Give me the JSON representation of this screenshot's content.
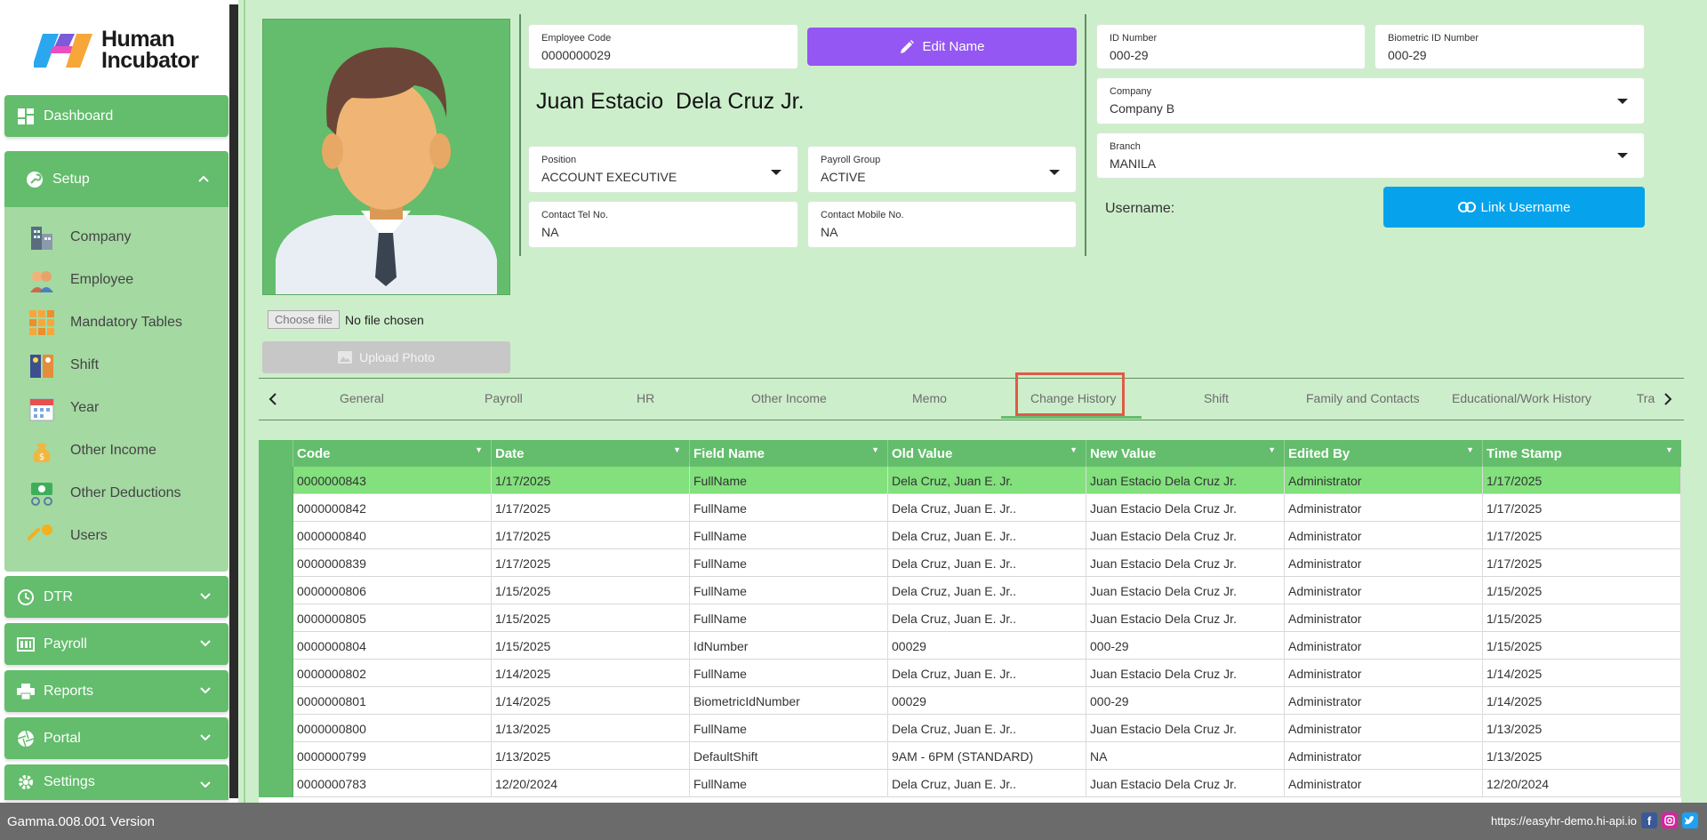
{
  "brand": {
    "line1": "Human",
    "line2": "Incubator"
  },
  "sidebar": {
    "dashboard": "Dashboard",
    "setup": "Setup",
    "setup_items": [
      {
        "label": "Company",
        "icon": "building-icon"
      },
      {
        "label": "Employee",
        "icon": "people-icon"
      },
      {
        "label": "Mandatory Tables",
        "icon": "grid-icon"
      },
      {
        "label": "Shift",
        "icon": "shift-icon"
      },
      {
        "label": "Year",
        "icon": "calendar-icon"
      },
      {
        "label": "Other Income",
        "icon": "money-bag-icon"
      },
      {
        "label": "Other Deductions",
        "icon": "deduction-icon"
      },
      {
        "label": "Users",
        "icon": "key-icon"
      }
    ],
    "dtr": "DTR",
    "payroll": "Payroll",
    "reports": "Reports",
    "portal": "Portal",
    "settings": "Settings"
  },
  "employee": {
    "code_label": "Employee Code",
    "code": "0000000029",
    "edit_name": "Edit Name",
    "full_name": "Juan Estacio  Dela Cruz Jr.",
    "position_label": "Position",
    "position": "ACCOUNT EXECUTIVE",
    "payroll_group_label": "Payroll Group",
    "payroll_group": "ACTIVE",
    "contact_tel_label": "Contact Tel No.",
    "contact_tel": "NA",
    "contact_mobile_label": "Contact Mobile No.",
    "contact_mobile": "NA",
    "id_number_label": "ID Number",
    "id_number": "000-29",
    "biometric_label": "Biometric ID Number",
    "biometric": "000-29",
    "company_label": "Company",
    "company": "Company B",
    "branch_label": "Branch",
    "branch": "MANILA",
    "username_label": "Username:",
    "link_username": "Link Username"
  },
  "photo": {
    "choose_file": "Choose file",
    "no_file": "No file chosen",
    "upload": "Upload Photo"
  },
  "tabs": [
    "General",
    "Payroll",
    "HR",
    "Other Income",
    "Memo",
    "Change History",
    "Shift",
    "Family and Contacts",
    "Educational/Work History",
    "Tra"
  ],
  "active_tab": "Change History",
  "table": {
    "columns": [
      "Code",
      "Date",
      "Field Name",
      "Old Value",
      "New Value",
      "Edited By",
      "Time Stamp"
    ],
    "rows": [
      [
        "0000000843",
        "1/17/2025",
        "FullName",
        "Dela Cruz, Juan E. Jr.",
        "Juan Estacio Dela Cruz Jr.",
        "Administrator",
        "1/17/2025"
      ],
      [
        "0000000842",
        "1/17/2025",
        "FullName",
        "Dela Cruz, Juan E. Jr..",
        "Juan Estacio Dela Cruz Jr.",
        "Administrator",
        "1/17/2025"
      ],
      [
        "0000000840",
        "1/17/2025",
        "FullName",
        "Dela Cruz, Juan E. Jr..",
        "Juan Estacio Dela Cruz Jr.",
        "Administrator",
        "1/17/2025"
      ],
      [
        "0000000839",
        "1/17/2025",
        "FullName",
        "Dela Cruz, Juan E. Jr..",
        "Juan Estacio Dela Cruz Jr.",
        "Administrator",
        "1/17/2025"
      ],
      [
        "0000000806",
        "1/15/2025",
        "FullName",
        "Dela Cruz, Juan E. Jr..",
        "Juan Estacio Dela Cruz Jr.",
        "Administrator",
        "1/15/2025"
      ],
      [
        "0000000805",
        "1/15/2025",
        "FullName",
        "Dela Cruz, Juan E. Jr..",
        "Juan Estacio Dela Cruz Jr.",
        "Administrator",
        "1/15/2025"
      ],
      [
        "0000000804",
        "1/15/2025",
        "IdNumber",
        "00029",
        "000-29",
        "Administrator",
        "1/15/2025"
      ],
      [
        "0000000802",
        "1/14/2025",
        "FullName",
        "Dela Cruz, Juan E. Jr..",
        "Juan Estacio Dela Cruz Jr.",
        "Administrator",
        "1/14/2025"
      ],
      [
        "0000000801",
        "1/14/2025",
        "BiometricIdNumber",
        "00029",
        "000-29",
        "Administrator",
        "1/14/2025"
      ],
      [
        "0000000800",
        "1/13/2025",
        "FullName",
        "Dela Cruz, Juan E. Jr..",
        "Juan Estacio Dela Cruz Jr.",
        "Administrator",
        "1/13/2025"
      ],
      [
        "0000000799",
        "1/13/2025",
        "DefaultShift",
        "9AM - 6PM (STANDARD)",
        "NA",
        "Administrator",
        "1/13/2025"
      ],
      [
        "0000000783",
        "12/20/2024",
        "FullName",
        "Dela Cruz, Juan E. Jr..",
        "Juan Estacio Dela Cruz Jr.",
        "Administrator",
        "12/20/2024"
      ]
    ]
  },
  "footer": {
    "version": "Gamma.008.001 Version",
    "url": "https://easyhr-demo.hi-api.io"
  },
  "colors": {
    "accent": "#63bd6c",
    "edit": "#9457f3",
    "link": "#06a3ec",
    "highlight": "#e05a47"
  }
}
